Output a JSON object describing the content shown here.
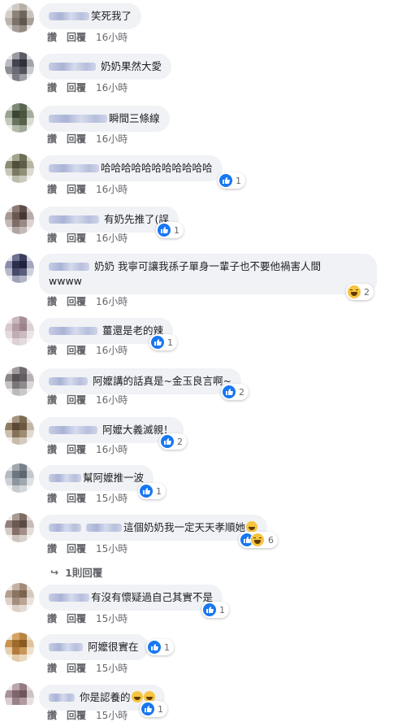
{
  "labels": {
    "like": "讚",
    "reply": "回覆"
  },
  "comments": [
    {
      "text": "笑死我了",
      "time": "16小時",
      "reactions": null,
      "reaction_icons": []
    },
    {
      "text": "奶奶果然大愛",
      "time": "16小時",
      "reactions": null,
      "reaction_icons": []
    },
    {
      "text": "瞬間三條線",
      "time": "16小時",
      "reactions": null,
      "reaction_icons": []
    },
    {
      "text": "哈哈哈哈哈哈哈哈哈哈哈",
      "time": "16小時",
      "reactions": "1",
      "reaction_icons": [
        "like-icon"
      ]
    },
    {
      "text": "有奶先推了(誤",
      "time": "16小時",
      "reactions": "1",
      "reaction_icons": [
        "like-icon"
      ]
    },
    {
      "text": "奶奶 我寧可讓我孫子單身一輩子也不要他禍害人間\nwwww",
      "time": "16小時",
      "reactions": "2",
      "reaction_icons": [
        "haha-icon"
      ]
    },
    {
      "text": "薑還是老的辣",
      "time": "16小時",
      "reactions": "1",
      "reaction_icons": [
        "like-icon"
      ]
    },
    {
      "text": "阿嬤講的話真是~金玉良言啊~",
      "time": "16小時",
      "reactions": "2",
      "reaction_icons": [
        "like-icon"
      ]
    },
    {
      "text": "阿嬤大義滅親！",
      "time": "16小時",
      "reactions": "2",
      "reaction_icons": [
        "like-icon"
      ]
    },
    {
      "text": "幫阿嬤推一波",
      "time": "15小時",
      "reactions": "1",
      "reaction_icons": [
        "like-icon"
      ]
    },
    {
      "text": "這個奶奶我一定天天孝順她",
      "time": "15小時",
      "reactions": "6",
      "reaction_icons": [
        "like-icon",
        "haha-icon"
      ]
    },
    {
      "text": "有沒有懷疑過自己其實不是",
      "time": "15小時",
      "reactions": "1",
      "reaction_icons": [
        "like-icon"
      ]
    },
    {
      "text": "阿嬤很實在",
      "time": "15小時",
      "reactions": "1",
      "reaction_icons": [
        "like-icon"
      ]
    },
    {
      "text": "你是認養的",
      "time": "15小時",
      "reactions": "1",
      "reaction_icons": [
        "like-icon"
      ]
    }
  ],
  "replies_link": "1則回覆"
}
